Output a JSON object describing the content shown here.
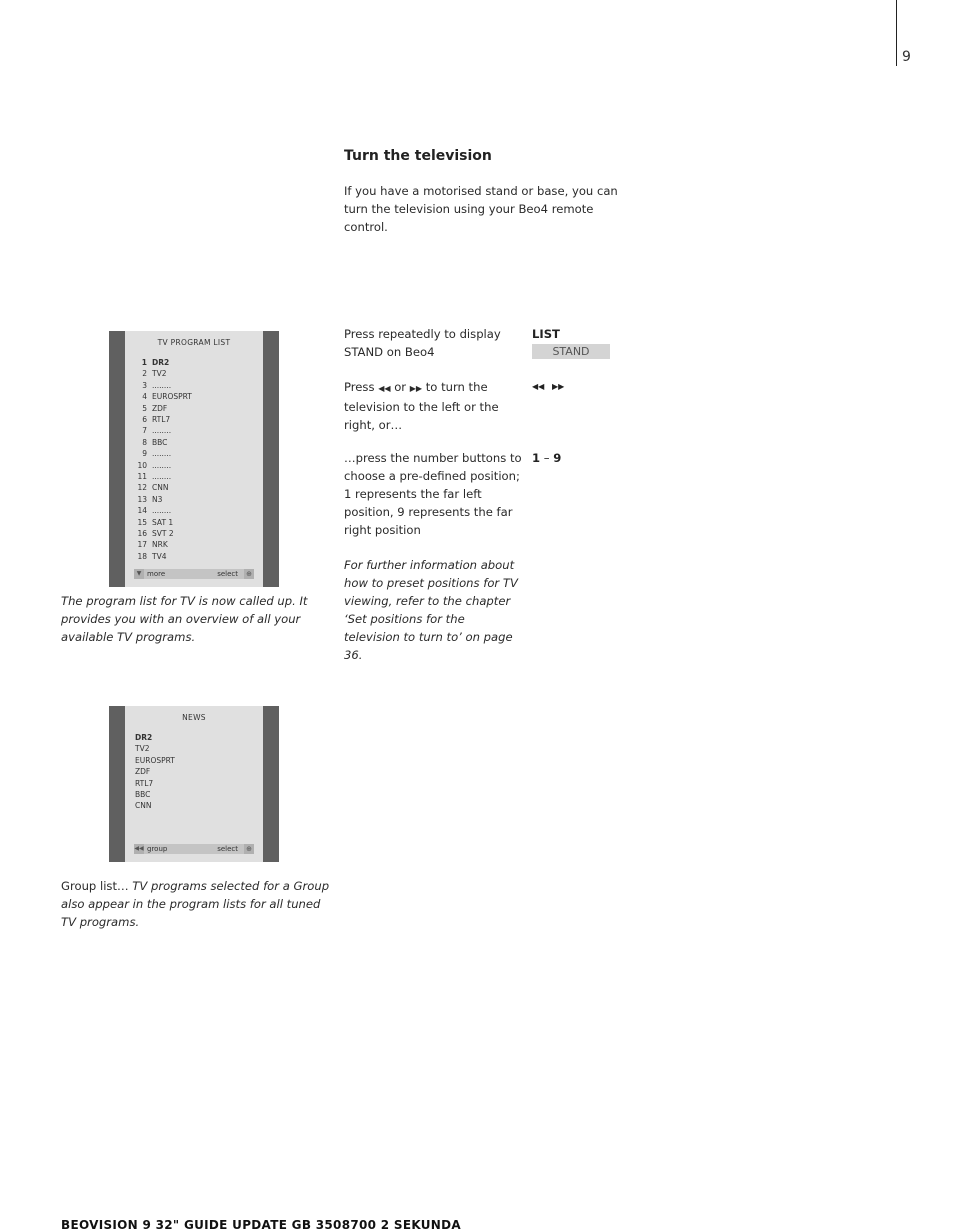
{
  "page_number": "9",
  "heading": "Turn the television",
  "intro": "If you have a motorised stand or base, you can turn the television using your Beo4 remote control.",
  "steps": [
    {
      "text": "Press repeatedly to display STAND on Beo4",
      "key": "LIST",
      "display": "STAND"
    },
    {
      "text_before": "Press ",
      "icon_rewind": "⏪",
      "text_mid": " or ",
      "icon_ff": "⏩",
      "text_after": " to turn the television to the left or the right, or…",
      "key_rewind": "◀◀",
      "key_ff": "▶▶"
    },
    {
      "text": "…press the number buttons to choose a pre-defined position; 1 represents the far left position, 9 represents the far right position",
      "key_from": "1",
      "key_dash": "–",
      "key_to": "9"
    }
  ],
  "note": "For further information about how to preset positions for TV viewing, refer to the chapter ‘Set positions for the television to turn to’ on page 36.",
  "program_list": {
    "title": "TV  PROGRAM  LIST",
    "rows": [
      {
        "num": "1",
        "name": "DR2",
        "bold": true
      },
      {
        "num": "2",
        "name": "TV2"
      },
      {
        "num": "3",
        "name": "........"
      },
      {
        "num": "4",
        "name": "EUROSPRT"
      },
      {
        "num": "5",
        "name": "ZDF"
      },
      {
        "num": "6",
        "name": "RTL7"
      },
      {
        "num": "7",
        "name": "........"
      },
      {
        "num": "8",
        "name": "BBC"
      },
      {
        "num": "9",
        "name": "........"
      },
      {
        "num": "10",
        "name": "........"
      },
      {
        "num": "11",
        "name": "........"
      },
      {
        "num": "12",
        "name": "CNN"
      },
      {
        "num": "13",
        "name": "N3"
      },
      {
        "num": "14",
        "name": "........"
      },
      {
        "num": "15",
        "name": "SAT 1"
      },
      {
        "num": "16",
        "name": "SVT 2"
      },
      {
        "num": "17",
        "name": "NRK"
      },
      {
        "num": "18",
        "name": "TV4"
      }
    ],
    "footer": {
      "icon": "▼",
      "label": "more",
      "select": "select",
      "globe_icon": "⊕"
    },
    "caption": "The program list for TV is now called up. It provides you with an overview of all your available TV programs."
  },
  "group_list": {
    "title": "NEWS",
    "rows": [
      {
        "name": "DR2",
        "bold": true
      },
      {
        "name": "TV2"
      },
      {
        "name": "EUROSPRT"
      },
      {
        "name": "ZDF"
      },
      {
        "name": "RTL7"
      },
      {
        "name": "BBC"
      },
      {
        "name": "CNN"
      }
    ],
    "footer": {
      "icon": "◀◀",
      "label": "group",
      "select": "select",
      "globe_icon": "⊕"
    },
    "caption_lead": "Group list… ",
    "caption_rest": "TV programs selected for a Group also appear in the program lists for all tuned TV programs."
  },
  "footer_text": "BEOVISION 9 32\" GUIDE UPDATE GB 3508700 2  SEKUNDA"
}
